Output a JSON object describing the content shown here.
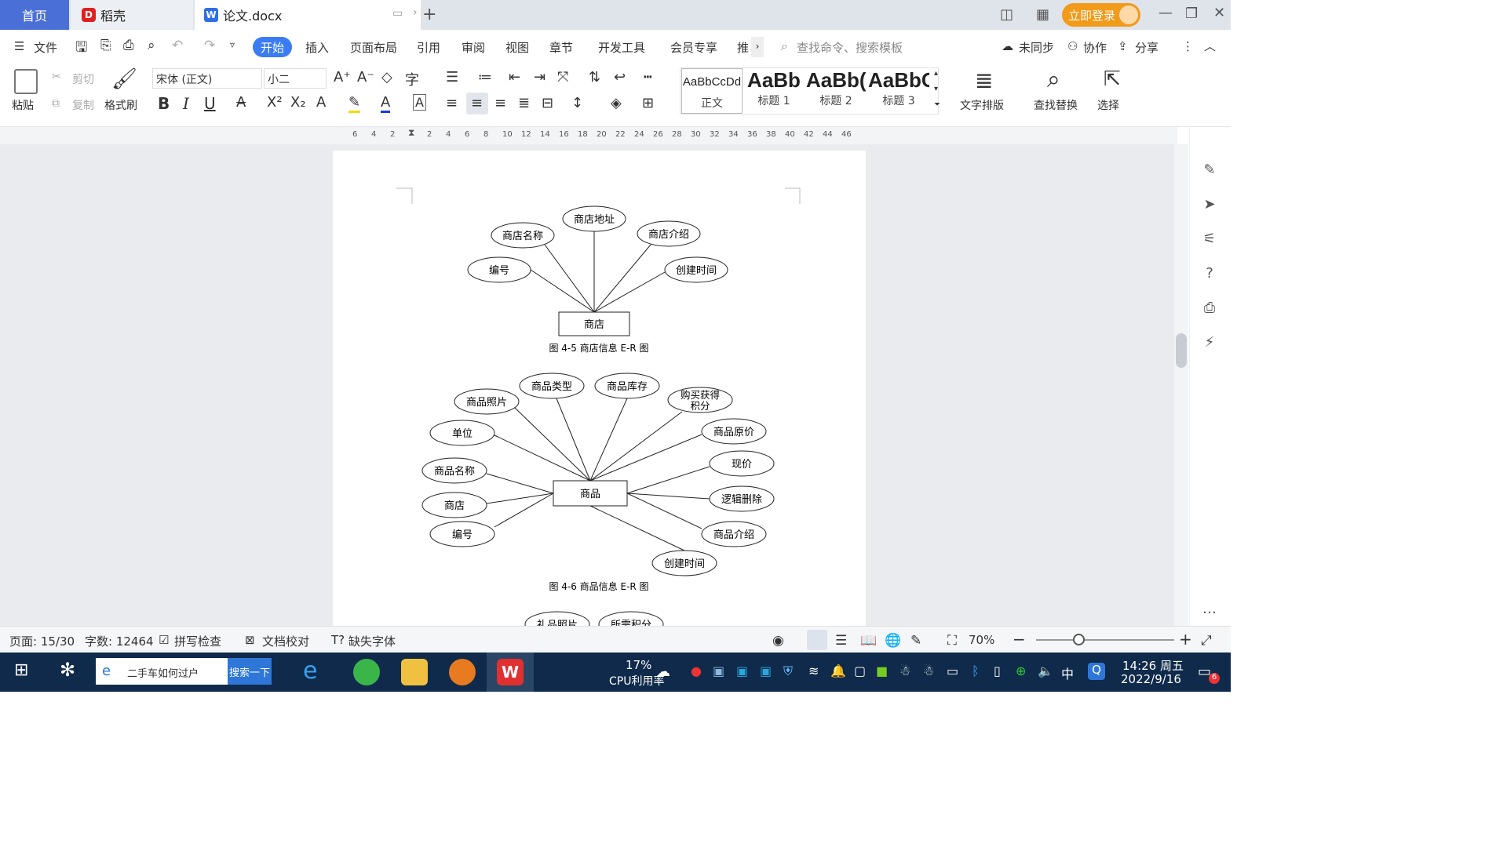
{
  "tabs": {
    "home": "首页",
    "daoke": "稻壳",
    "doc": "论文.docx",
    "login": "立即登录"
  },
  "menu": {
    "file": "文件",
    "start": "开始",
    "items": [
      "插入",
      "页面布局",
      "引用",
      "审阅",
      "视图",
      "章节",
      "开发工具",
      "会员专享",
      "推"
    ],
    "search_placeholder": "查找命令、搜索模板",
    "unsynced": "未同步",
    "collab": "协作",
    "share": "分享"
  },
  "ribbon": {
    "paste": "粘贴",
    "cut": "剪切",
    "copy": "复制",
    "format_painter": "格式刷",
    "font_name": "宋体 (正文)",
    "font_size": "小二",
    "styles": [
      {
        "sample": "AaBbCcDd",
        "label": "正文"
      },
      {
        "sample": "AaBb",
        "label": "标题 1"
      },
      {
        "sample": "AaBb(",
        "label": "标题 2"
      },
      {
        "sample": "AaBbC",
        "label": "标题 3"
      }
    ],
    "text_layout": "文字排版",
    "find_replace": "查找替换",
    "select": "选择"
  },
  "ruler_ticks": [
    "6",
    "4",
    "2",
    "2",
    "4",
    "6",
    "8",
    "10",
    "12",
    "14",
    "16",
    "18",
    "20",
    "22",
    "24",
    "26",
    "28",
    "30",
    "32",
    "34",
    "36",
    "38",
    "40",
    "42",
    "44",
    "46"
  ],
  "diagram1": {
    "entity": "商店",
    "attributes": [
      "编号",
      "商店名称",
      "商店地址",
      "商店介绍",
      "创建时间"
    ],
    "caption": "图 4-5 商店信息 E-R 图"
  },
  "diagram2": {
    "entity": "商品",
    "attributes": [
      "商品照片",
      "商品类型",
      "商品库存",
      "购买获得积分",
      "单位",
      "商品原价",
      "商品名称",
      "现价",
      "商店",
      "逻辑删除",
      "编号",
      "商品介绍",
      "创建时间"
    ],
    "caption": "图 4-6 商品信息 E-R 图"
  },
  "diagram3_partial": [
    "礼品照片",
    "所需积分"
  ],
  "status": {
    "page": "页面: 15/30",
    "words": "字数: 12464",
    "spell": "拼写检查",
    "proof": "文档校对",
    "missing_font": "缺失字体",
    "zoom": "70%"
  },
  "taskbar": {
    "search_text": "二手车如何过户",
    "search_btn": "搜索一下",
    "cpu_pct": "17%",
    "cpu_label": "CPU利用率",
    "ime": "中",
    "time": "14:26 周五",
    "date": "2022/9/16",
    "badge": "6"
  }
}
